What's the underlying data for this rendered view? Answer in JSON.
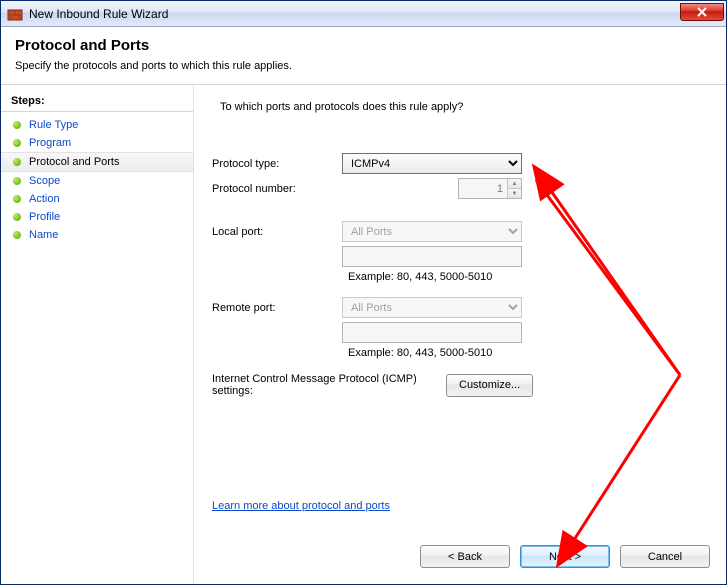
{
  "window": {
    "title": "New Inbound Rule Wizard"
  },
  "header": {
    "title": "Protocol and Ports",
    "subtitle": "Specify the protocols and ports to which this rule applies."
  },
  "sidebar": {
    "heading": "Steps:",
    "items": [
      {
        "label": "Rule Type",
        "current": false
      },
      {
        "label": "Program",
        "current": false
      },
      {
        "label": "Protocol and Ports",
        "current": true
      },
      {
        "label": "Scope",
        "current": false
      },
      {
        "label": "Action",
        "current": false
      },
      {
        "label": "Profile",
        "current": false
      },
      {
        "label": "Name",
        "current": false
      }
    ]
  },
  "content": {
    "prompt": "To which ports and protocols does this rule apply?",
    "protocolTypeLabel": "Protocol type:",
    "protocolType": {
      "selected": "ICMPv4"
    },
    "protocolNumberLabel": "Protocol number:",
    "protocolNumber": "1",
    "localPortLabel": "Local port:",
    "localPortSelected": "All Ports",
    "localPortValue": "",
    "localExample": "Example: 80, 443, 5000-5010",
    "remotePortLabel": "Remote port:",
    "remotePortSelected": "All Ports",
    "remotePortValue": "",
    "remoteExample": "Example: 80, 443, 5000-5010",
    "icmpLabel": "Internet Control Message Protocol (ICMP) settings:",
    "customizeBtn": "Customize...",
    "learnMore": "Learn more about protocol and ports"
  },
  "buttons": {
    "back": "< Back",
    "next": "Next >",
    "cancel": "Cancel"
  }
}
